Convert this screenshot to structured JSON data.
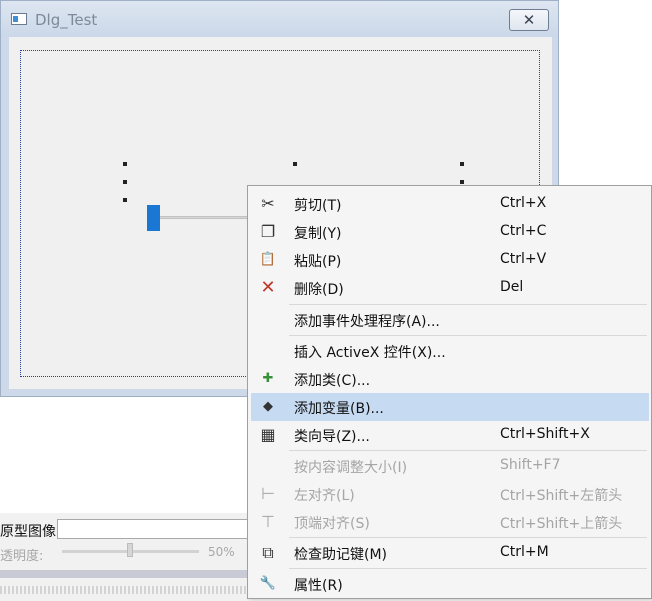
{
  "window": {
    "title": "Dlg_Test",
    "close_glyph": "✕"
  },
  "bottom_panel": {
    "image_label": "原型图像:",
    "opacity_label": "透明度:",
    "opacity_value": "50%",
    "opacity_level_fraction": 0.5
  },
  "context_menu": {
    "items": [
      {
        "label": "剪切(T)",
        "shortcut": "Ctrl+X",
        "icon": "scissors-icon",
        "glyph": "✂",
        "enabled": true
      },
      {
        "label": "复制(Y)",
        "shortcut": "Ctrl+C",
        "icon": "copy-icon",
        "glyph": "❐",
        "enabled": true
      },
      {
        "label": "粘贴(P)",
        "shortcut": "Ctrl+V",
        "icon": "paste-icon",
        "glyph": "📋",
        "enabled": true
      },
      {
        "label": "删除(D)",
        "shortcut": "Del",
        "icon": "delete-icon",
        "glyph": "✕",
        "enabled": true
      },
      {
        "label": "添加事件处理程序(A)...",
        "shortcut": "",
        "icon": "",
        "glyph": "",
        "enabled": true
      },
      {
        "label": "插入 ActiveX 控件(X)...",
        "shortcut": "",
        "icon": "",
        "glyph": "",
        "enabled": true
      },
      {
        "label": "添加类(C)...",
        "shortcut": "",
        "icon": "add-class-icon",
        "glyph": "✚",
        "enabled": true
      },
      {
        "label": "添加变量(B)...",
        "shortcut": "",
        "icon": "add-variable-icon",
        "glyph": "◆",
        "enabled": true,
        "highlighted": true
      },
      {
        "label": "类向导(Z)...",
        "shortcut": "Ctrl+Shift+X",
        "icon": "class-wizard-icon",
        "glyph": "▦",
        "enabled": true
      },
      {
        "label": "按内容调整大小(I)",
        "shortcut": "Shift+F7",
        "icon": "",
        "glyph": "",
        "enabled": false
      },
      {
        "label": "左对齐(L)",
        "shortcut": "Ctrl+Shift+左箭头",
        "icon": "align-left-icon",
        "glyph": "⊢",
        "enabled": false
      },
      {
        "label": "顶端对齐(S)",
        "shortcut": "Ctrl+Shift+上箭头",
        "icon": "align-top-icon",
        "glyph": "⊤",
        "enabled": false
      },
      {
        "label": "检查助记键(M)",
        "shortcut": "Ctrl+M",
        "icon": "check-mnemonics-icon",
        "glyph": "⧉",
        "enabled": true
      },
      {
        "label": "属性(R)",
        "shortcut": "",
        "icon": "wrench-icon",
        "glyph": "🔧",
        "enabled": true
      }
    ]
  },
  "colors": {
    "highlight": "#c6daf2",
    "delete_icon": "#c0392b",
    "slider_thumb": "#1a78d4",
    "selection_frame": "#2c3c9c"
  }
}
